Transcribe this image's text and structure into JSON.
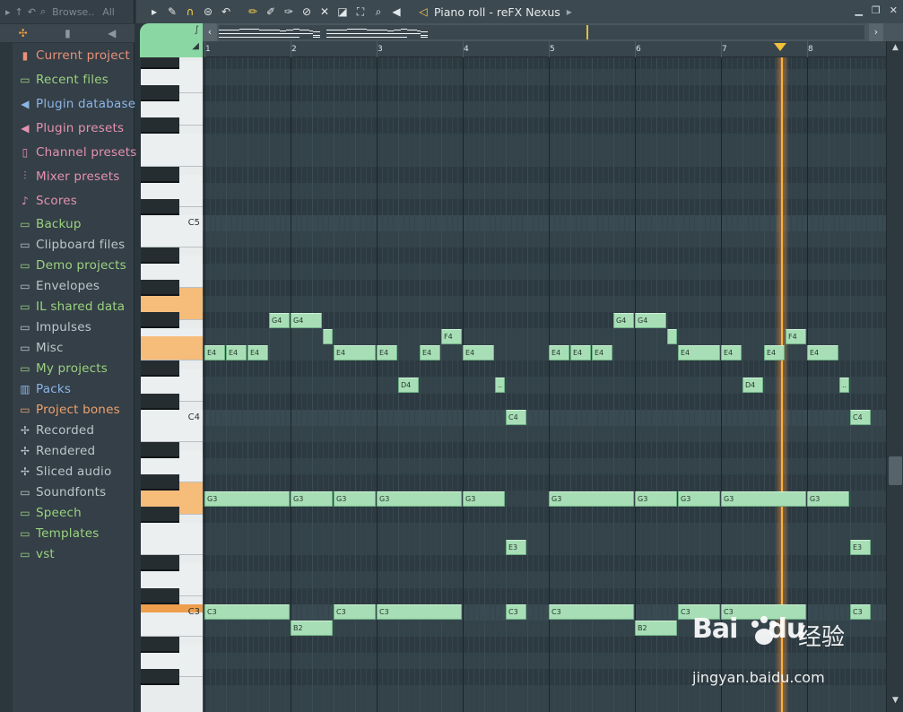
{
  "browser": {
    "title": "Browse..",
    "filter": "All",
    "items": [
      {
        "label": "Current project",
        "color": "#e8917a",
        "icon": "project-icon",
        "glyph": "▮"
      },
      {
        "label": "Recent files",
        "color": "#9bd27f",
        "icon": "recent-folder-icon",
        "glyph": "▭"
      },
      {
        "label": "Plugin database",
        "color": "#8cb5e6",
        "icon": "plugin-database-icon",
        "glyph": "◀"
      },
      {
        "label": "Plugin presets",
        "color": "#e592b1",
        "icon": "plugin-presets-icon",
        "glyph": "◀"
      },
      {
        "label": "Channel presets",
        "color": "#e592b1",
        "icon": "channel-presets-icon",
        "glyph": "▯"
      },
      {
        "label": "Mixer presets",
        "color": "#e592b1",
        "icon": "mixer-presets-icon",
        "glyph": "⫶"
      },
      {
        "label": "Scores",
        "color": "#e592b1",
        "icon": "scores-icon",
        "glyph": "♪"
      },
      {
        "label": "Backup",
        "color": "#9bd27f",
        "icon": "backup-folder-icon",
        "glyph": "▭"
      },
      {
        "label": "Clipboard files",
        "color": "#bcc6cb",
        "icon": "folder-icon",
        "glyph": "▭"
      },
      {
        "label": "Demo projects",
        "color": "#9bd27f",
        "icon": "folder-icon",
        "glyph": "▭"
      },
      {
        "label": "Envelopes",
        "color": "#bcc6cb",
        "icon": "folder-icon",
        "glyph": "▭"
      },
      {
        "label": "IL shared data",
        "color": "#9bd27f",
        "icon": "folder-icon",
        "glyph": "▭"
      },
      {
        "label": "Impulses",
        "color": "#bcc6cb",
        "icon": "folder-icon",
        "glyph": "▭"
      },
      {
        "label": "Misc",
        "color": "#bcc6cb",
        "icon": "folder-icon",
        "glyph": "▭"
      },
      {
        "label": "My projects",
        "color": "#9bd27f",
        "icon": "folder-icon",
        "glyph": "▭"
      },
      {
        "label": "Packs",
        "color": "#8cb5e6",
        "icon": "packs-icon",
        "glyph": "▥"
      },
      {
        "label": "Project bones",
        "color": "#f0a26c",
        "icon": "folder-icon",
        "glyph": "▭"
      },
      {
        "label": "Recorded",
        "color": "#bcc6cb",
        "icon": "audio-icon",
        "glyph": "✢"
      },
      {
        "label": "Rendered",
        "color": "#bcc6cb",
        "icon": "audio-icon",
        "glyph": "✢"
      },
      {
        "label": "Sliced audio",
        "color": "#bcc6cb",
        "icon": "audio-icon",
        "glyph": "✢"
      },
      {
        "label": "Soundfonts",
        "color": "#bcc6cb",
        "icon": "folder-icon",
        "glyph": "▭"
      },
      {
        "label": "Speech",
        "color": "#9bd27f",
        "icon": "folder-icon",
        "glyph": "▭"
      },
      {
        "label": "Templates",
        "color": "#9bd27f",
        "icon": "folder-icon",
        "glyph": "▭"
      },
      {
        "label": "vst",
        "color": "#9bd27f",
        "icon": "folder-icon",
        "glyph": "▭"
      }
    ]
  },
  "piano_roll": {
    "title": "Piano roll - reFX Nexus",
    "bars": [
      "1",
      "2",
      "3",
      "4",
      "5",
      "6",
      "7",
      "8"
    ],
    "key_labels": {
      "c5": "C5",
      "c4": "C4",
      "c3": "C3"
    },
    "notes": [
      {
        "label": "G4",
        "row": 3,
        "bar": 1.75,
        "len": 0.25
      },
      {
        "label": "G4",
        "row": 3,
        "bar": 2.0,
        "len": 0.375
      },
      {
        "label": "G4",
        "row": 3,
        "bar": 5.75,
        "len": 0.25
      },
      {
        "label": "G4",
        "row": 3,
        "bar": 6.0,
        "len": 0.375
      },
      {
        "label": "",
        "row": 4,
        "bar": 2.375,
        "len": 0.125
      },
      {
        "label": "F4",
        "row": 4,
        "bar": 3.75,
        "len": 0.25
      },
      {
        "label": "",
        "row": 4,
        "bar": 6.375,
        "len": 0.125
      },
      {
        "label": "F4",
        "row": 4,
        "bar": 7.75,
        "len": 0.25
      },
      {
        "label": "E4",
        "row": 5,
        "bar": 1.0,
        "len": 0.25
      },
      {
        "label": "E4",
        "row": 5,
        "bar": 1.25,
        "len": 0.25
      },
      {
        "label": "E4",
        "row": 5,
        "bar": 1.5,
        "len": 0.25
      },
      {
        "label": "E4",
        "row": 5,
        "bar": 2.5,
        "len": 0.5
      },
      {
        "label": "E4",
        "row": 5,
        "bar": 3.0,
        "len": 0.25
      },
      {
        "label": "E4",
        "row": 5,
        "bar": 3.5,
        "len": 0.25
      },
      {
        "label": "E4",
        "row": 5,
        "bar": 4.0,
        "len": 0.375
      },
      {
        "label": "E4",
        "row": 5,
        "bar": 5.0,
        "len": 0.25
      },
      {
        "label": "E4",
        "row": 5,
        "bar": 5.25,
        "len": 0.25
      },
      {
        "label": "E4",
        "row": 5,
        "bar": 5.5,
        "len": 0.25
      },
      {
        "label": "E4",
        "row": 5,
        "bar": 6.5,
        "len": 0.5
      },
      {
        "label": "E4",
        "row": 5,
        "bar": 7.0,
        "len": 0.25
      },
      {
        "label": "E4",
        "row": 5,
        "bar": 7.5,
        "len": 0.25
      },
      {
        "label": "E4",
        "row": 5,
        "bar": 8.0,
        "len": 0.375
      },
      {
        "label": "D4",
        "row": 7,
        "bar": 3.25,
        "len": 0.25
      },
      {
        "label": "..",
        "row": 7,
        "bar": 4.375,
        "len": 0.125
      },
      {
        "label": "D4",
        "row": 7,
        "bar": 7.25,
        "len": 0.25
      },
      {
        "label": "..",
        "row": 7,
        "bar": 8.375,
        "len": 0.125
      },
      {
        "label": "C4",
        "row": 9,
        "bar": 4.5,
        "len": 0.25
      },
      {
        "label": "C4",
        "row": 9,
        "bar": 8.5,
        "len": 0.25
      },
      {
        "label": "G3",
        "row": 14,
        "bar": 1.0,
        "len": 1.0
      },
      {
        "label": "G3",
        "row": 14,
        "bar": 2.0,
        "len": 0.5
      },
      {
        "label": "G3",
        "row": 14,
        "bar": 2.5,
        "len": 0.5
      },
      {
        "label": "G3",
        "row": 14,
        "bar": 3.0,
        "len": 1.0
      },
      {
        "label": "G3",
        "row": 14,
        "bar": 4.0,
        "len": 0.5
      },
      {
        "label": "G3",
        "row": 14,
        "bar": 5.0,
        "len": 1.0
      },
      {
        "label": "G3",
        "row": 14,
        "bar": 6.0,
        "len": 0.5
      },
      {
        "label": "G3",
        "row": 14,
        "bar": 6.5,
        "len": 0.5
      },
      {
        "label": "G3",
        "row": 14,
        "bar": 7.0,
        "len": 1.0
      },
      {
        "label": "G3",
        "row": 14,
        "bar": 8.0,
        "len": 0.5
      },
      {
        "label": "E3",
        "row": 17,
        "bar": 4.5,
        "len": 0.25
      },
      {
        "label": "E3",
        "row": 17,
        "bar": 8.5,
        "len": 0.25
      },
      {
        "label": "C3",
        "row": 21,
        "bar": 1.0,
        "len": 1.0
      },
      {
        "label": "C3",
        "row": 21,
        "bar": 2.5,
        "len": 0.5
      },
      {
        "label": "C3",
        "row": 21,
        "bar": 3.0,
        "len": 1.0
      },
      {
        "label": "C3",
        "row": 21,
        "bar": 4.5,
        "len": 0.25
      },
      {
        "label": "C3",
        "row": 21,
        "bar": 5.0,
        "len": 1.0
      },
      {
        "label": "C3",
        "row": 21,
        "bar": 6.5,
        "len": 0.5
      },
      {
        "label": "C3",
        "row": 21,
        "bar": 7.0,
        "len": 1.0
      },
      {
        "label": "C3",
        "row": 21,
        "bar": 8.5,
        "len": 0.25
      },
      {
        "label": "B2",
        "row": 22,
        "bar": 2.0,
        "len": 0.5
      },
      {
        "label": "B2",
        "row": 22,
        "bar": 6.0,
        "len": 0.5
      }
    ]
  },
  "watermark": {
    "logo": "Bai",
    "logo_suffix": "du",
    "cn": "经验",
    "url": "jingyan.baidu.com"
  }
}
